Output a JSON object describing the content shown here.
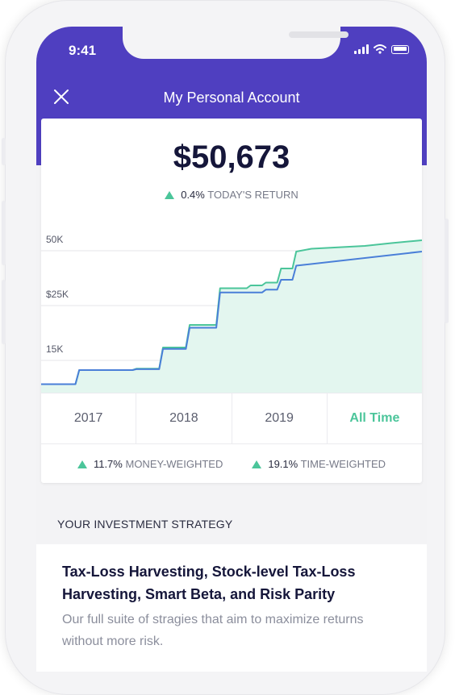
{
  "status_bar": {
    "time": "9:41"
  },
  "header": {
    "title": "My Personal Account",
    "close_icon": "close-icon",
    "color": "#4f3fc0"
  },
  "summary": {
    "balance": "$50,673",
    "todays_return": {
      "value": "0.4%",
      "label": "TODAY'S RETURN",
      "direction": "up"
    }
  },
  "chart_data": {
    "type": "area",
    "y_tick_labels": [
      "50K",
      "$25K",
      "15K"
    ],
    "grid": true,
    "series": [
      {
        "name": "",
        "color": "#4bc59a",
        "fill": "#e3f6ef",
        "x": [
          0,
          0.09,
          0.1,
          0.24,
          0.25,
          0.31,
          0.32,
          0.38,
          0.39,
          0.46,
          0.47,
          0.54,
          0.55,
          0.58,
          0.59,
          0.62,
          0.63,
          0.66,
          0.67,
          0.71,
          0.78,
          0.85,
          0.92,
          1.0
        ],
        "values": [
          3,
          3,
          8,
          8,
          8.5,
          8.5,
          16,
          16,
          24,
          24,
          37,
          37,
          38,
          38,
          39,
          39,
          44,
          44,
          50,
          51,
          51.5,
          52,
          53,
          54
        ]
      },
      {
        "name": "",
        "color": "#4a7fd8",
        "x": [
          0,
          0.09,
          0.1,
          0.24,
          0.25,
          0.31,
          0.32,
          0.38,
          0.39,
          0.46,
          0.47,
          0.54,
          0.55,
          0.58,
          0.59,
          0.62,
          0.63,
          0.66,
          0.67,
          1.0
        ],
        "values": [
          3,
          3,
          8,
          8,
          8.3,
          8.3,
          15.5,
          15.5,
          23,
          23,
          35.5,
          35.5,
          35.5,
          35.5,
          36.5,
          36.5,
          40,
          40,
          45,
          50
        ]
      }
    ]
  },
  "periods": [
    {
      "label": "2017",
      "active": false
    },
    {
      "label": "2018",
      "active": false
    },
    {
      "label": "2019",
      "active": false
    },
    {
      "label": "All Time",
      "active": true
    }
  ],
  "returns": {
    "money_weighted": {
      "value": "11.7%",
      "label": "MONEY-WEIGHTED"
    },
    "time_weighted": {
      "value": "19.1%",
      "label": "TIME-WEIGHTED"
    }
  },
  "strategy": {
    "section_label": "YOUR INVESTMENT STRATEGY",
    "title": "Tax-Loss Harvesting, Stock-level Tax-Loss Harvesting, Smart Beta, and Risk Parity",
    "description": "Our full suite of stragies that aim to maximize returns without more risk."
  },
  "colors": {
    "accent": "#4bc59a",
    "brand": "#4f3fc0",
    "line_blue": "#4a7fd8"
  }
}
